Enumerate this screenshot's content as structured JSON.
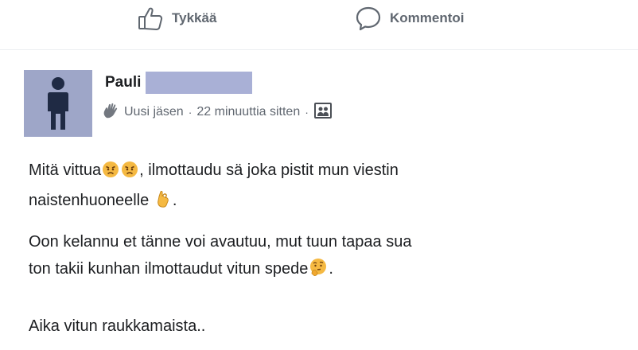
{
  "actions": {
    "like_label": "Tykkää",
    "like_icon": "thumbs-up-icon",
    "comment_label": "Kommentoi",
    "comment_icon": "speech-bubble-icon"
  },
  "post": {
    "author_first_name": "Pauli",
    "author_badge_icon": "waving-hand-icon",
    "author_badge": "Uusi jäsen",
    "separator": "·",
    "timestamp": "22 minuuttia sitten",
    "audience_icon": "group-audience-icon",
    "paragraphs": {
      "p1_a": "Mitä vittua",
      "p1_b": ", ilmottaudu sä joka pistit mun viestin",
      "p1_c": "naistenhuoneelle",
      "p1_d": ".",
      "p2_a": "Oon kelannu et tänne voi avautuu, mut tuun tapaa sua",
      "p2_b": "ton takii kunhan ilmottaudut vitun spede",
      "p2_c": ".",
      "p3": "Aika vitun raukkamaista.."
    },
    "emojis": [
      "angry-face-icon",
      "angry-face-icon",
      "ok-hand-icon",
      "thinking-face-icon"
    ]
  },
  "colors": {
    "text": "#1c1e21",
    "secondary_text": "#606770",
    "avatar_bg": "#9ea6c8",
    "redaction": "#a9b0d6"
  }
}
